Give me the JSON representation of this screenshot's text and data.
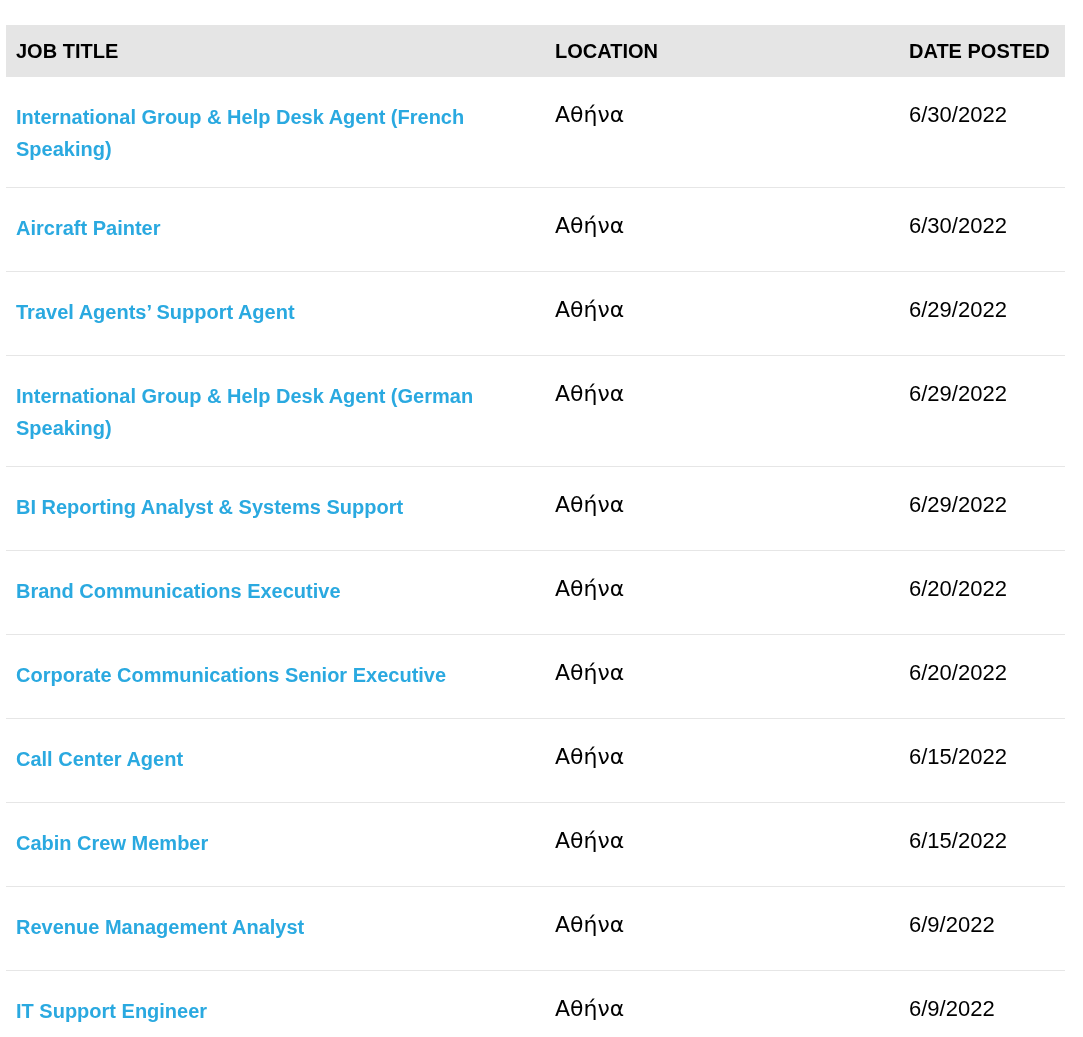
{
  "table": {
    "columns": [
      "JOB TITLE",
      "LOCATION",
      "DATE POSTED"
    ],
    "rows": [
      {
        "title": "International Group & Help Desk Agent (French Speaking)",
        "location": "Αθήνα",
        "date": "6/30/2022"
      },
      {
        "title": "Aircraft Painter",
        "location": "Αθήνα",
        "date": "6/30/2022"
      },
      {
        "title": "Travel Agents’ Support Agent",
        "location": "Αθήνα",
        "date": "6/29/2022"
      },
      {
        "title": "International Group & Help Desk Agent (German Speaking)",
        "location": "Αθήνα",
        "date": "6/29/2022"
      },
      {
        "title": "BI Reporting Analyst & Systems Support",
        "location": "Αθήνα",
        "date": "6/29/2022"
      },
      {
        "title": "Brand Communications Executive",
        "location": "Αθήνα",
        "date": "6/20/2022"
      },
      {
        "title": "Corporate Communications Senior Executive",
        "location": "Αθήνα",
        "date": "6/20/2022"
      },
      {
        "title": "Call Center Agent",
        "location": "Αθήνα",
        "date": "6/15/2022"
      },
      {
        "title": "Cabin Crew Member",
        "location": "Αθήνα",
        "date": "6/15/2022"
      },
      {
        "title": "Revenue Management Analyst",
        "location": "Αθήνα",
        "date": "6/9/2022"
      },
      {
        "title": "IT Support Engineer",
        "location": "Αθήνα",
        "date": "6/9/2022"
      }
    ]
  }
}
